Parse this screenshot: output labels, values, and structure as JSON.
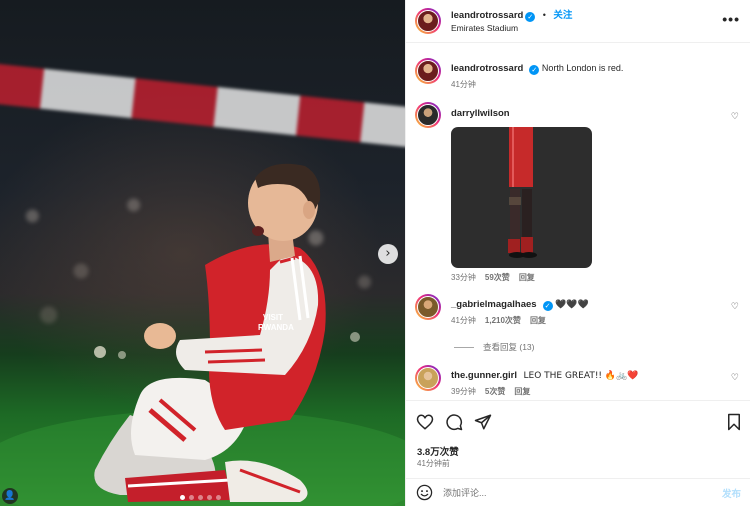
{
  "post": {
    "author": "leandrotrossard",
    "follow_separator": "•",
    "follow_label": "关注",
    "location": "Emirates Stadium",
    "more_icon": "more-horizontal-icon",
    "carousel_dots": 5,
    "active_dot": 0
  },
  "caption": {
    "author": "leandrotrossard",
    "text": "North London is red.",
    "time": "41分钟"
  },
  "comments": [
    {
      "user": "darryllwilson",
      "verified": false,
      "text": "",
      "has_sticker": true,
      "time": "33分钟",
      "likes": "59次赞",
      "reply": "回复"
    },
    {
      "user": "_gabrielmagalhaes",
      "verified": true,
      "text": "🖤🖤🖤",
      "time": "41分钟",
      "likes": "1,210次赞",
      "reply": "回复"
    },
    {
      "user": "the.gunner.girl",
      "verified": false,
      "text": "LEO THE GREAT!! 🔥🚲❤️",
      "time": "39分钟",
      "likes": "5次赞",
      "reply": "回复"
    }
  ],
  "view_replies": "查看回复 (13)",
  "engagement": {
    "likes": "3.8万次赞",
    "posted": "41分钟前"
  },
  "composer": {
    "placeholder": "添加评论...",
    "post_label": "发布"
  },
  "colors": {
    "accent": "#0095f6",
    "arsenal_red": "#d1232a",
    "post_disabled": "#b2dffc"
  }
}
